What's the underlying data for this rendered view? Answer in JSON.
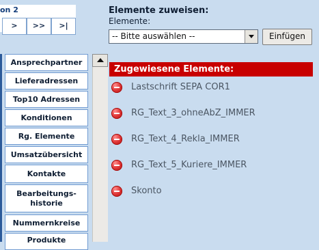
{
  "pager": {
    "title": "on 2",
    "buttons": [
      ">",
      ">>",
      ">|"
    ]
  },
  "assign": {
    "title": "Elemente zuweisen:",
    "field_label": "Elemente:",
    "select_value": "-- Bitte auswählen --",
    "insert_label": "Einfügen"
  },
  "nav": {
    "items": [
      "Ansprechpartner",
      "Lieferadressen",
      "Top10 Adressen",
      "Konditionen",
      "Rg. Elemente",
      "Umsatzübersicht",
      "Kontakte",
      "Bearbeitungs-historie",
      "Nummernkreise",
      "Produkte"
    ]
  },
  "assigned": {
    "header": "Zugewiesene Elemente:",
    "items": [
      "Lastschrift SEPA COR1",
      "RG_Text_3_ohneAbZ_IMMER",
      "RG_Text_4_Rekla_IMMER",
      "RG_Text_5_Kuriere_IMMER",
      "Skonto"
    ]
  },
  "colors": {
    "background": "#c9dcef",
    "header_red": "#c80000",
    "nav_border": "#6f9ad1"
  }
}
